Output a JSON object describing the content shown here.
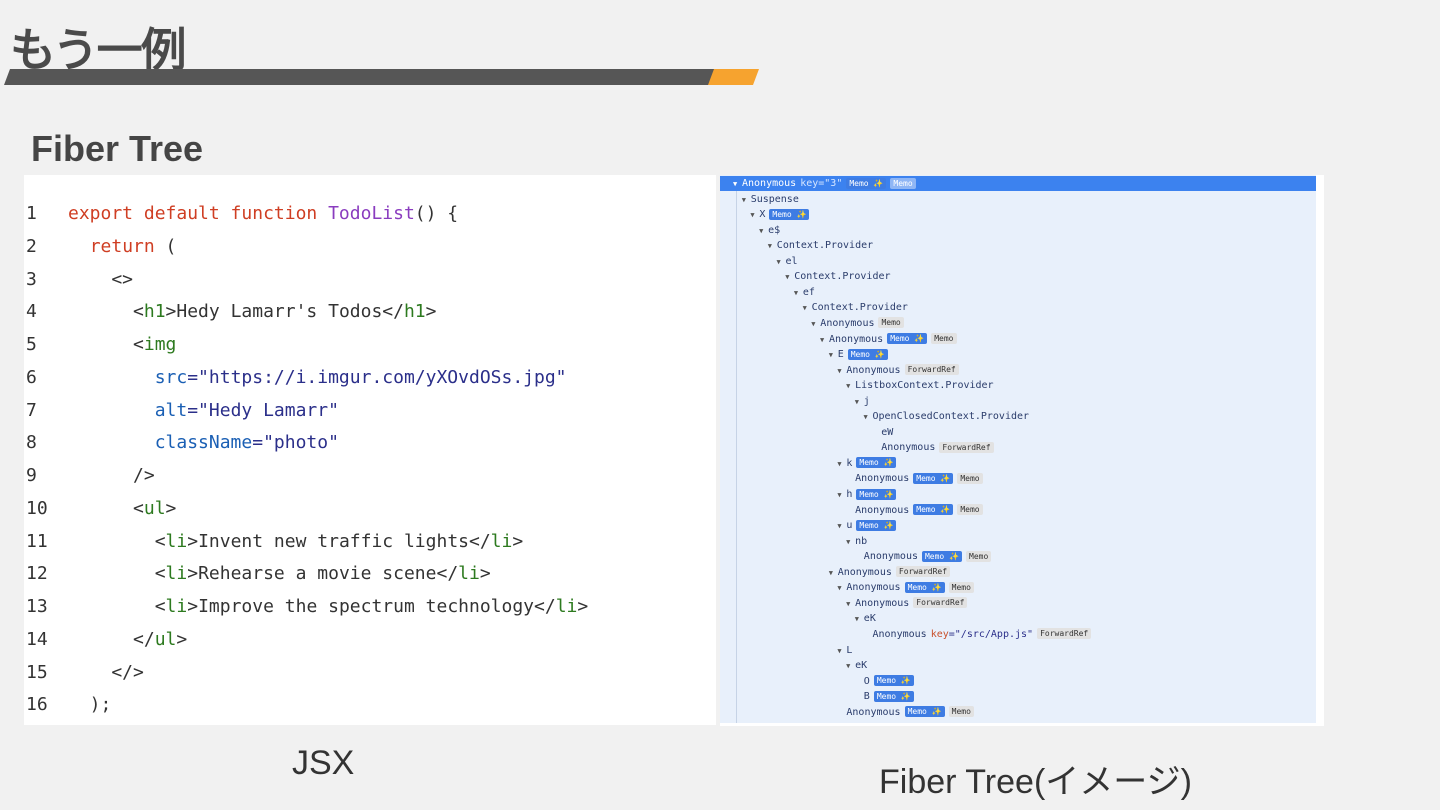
{
  "slide": {
    "title": "もう一例",
    "subtitle": "Fiber Tree",
    "caption_left": "JSX",
    "caption_right": "Fiber Tree(イメージ)",
    "accent_color": "#f6a32f",
    "bar_color": "#565656"
  },
  "code": {
    "lines": [
      {
        "n": "1",
        "tokens": [
          {
            "t": "export default function ",
            "c": "kw"
          },
          {
            "t": "TodoList",
            "c": "fn"
          },
          {
            "t": "() {",
            "c": ""
          }
        ]
      },
      {
        "n": "2",
        "tokens": [
          {
            "t": "  ",
            "c": ""
          },
          {
            "t": "return",
            "c": "kw"
          },
          {
            "t": " (",
            "c": ""
          }
        ]
      },
      {
        "n": "3",
        "tokens": [
          {
            "t": "    <>",
            "c": ""
          }
        ]
      },
      {
        "n": "4",
        "tokens": [
          {
            "t": "      <",
            "c": ""
          },
          {
            "t": "h1",
            "c": "tg"
          },
          {
            "t": ">Hedy Lamarr's Todos</",
            "c": ""
          },
          {
            "t": "h1",
            "c": "tg"
          },
          {
            "t": ">",
            "c": ""
          }
        ]
      },
      {
        "n": "5",
        "tokens": [
          {
            "t": "      <",
            "c": ""
          },
          {
            "t": "img",
            "c": "tg"
          }
        ]
      },
      {
        "n": "6",
        "tokens": [
          {
            "t": "        ",
            "c": ""
          },
          {
            "t": "src",
            "c": "at"
          },
          {
            "t": "=\"https://i.imgur.com/yXOvdOSs.jpg\"",
            "c": "st"
          }
        ]
      },
      {
        "n": "7",
        "tokens": [
          {
            "t": "        ",
            "c": ""
          },
          {
            "t": "alt",
            "c": "at"
          },
          {
            "t": "=\"Hedy Lamarr\"",
            "c": "st"
          }
        ]
      },
      {
        "n": "8",
        "tokens": [
          {
            "t": "        ",
            "c": ""
          },
          {
            "t": "className",
            "c": "at"
          },
          {
            "t": "=\"photo\"",
            "c": "st"
          }
        ]
      },
      {
        "n": "9",
        "tokens": [
          {
            "t": "      />",
            "c": ""
          }
        ]
      },
      {
        "n": "10",
        "tokens": [
          {
            "t": "      <",
            "c": ""
          },
          {
            "t": "ul",
            "c": "tg"
          },
          {
            "t": ">",
            "c": ""
          }
        ]
      },
      {
        "n": "11",
        "tokens": [
          {
            "t": "        <",
            "c": ""
          },
          {
            "t": "li",
            "c": "tg"
          },
          {
            "t": ">Invent new traffic lights</",
            "c": ""
          },
          {
            "t": "li",
            "c": "tg"
          },
          {
            "t": ">",
            "c": ""
          }
        ]
      },
      {
        "n": "12",
        "tokens": [
          {
            "t": "        <",
            "c": ""
          },
          {
            "t": "li",
            "c": "tg"
          },
          {
            "t": ">Rehearse a movie scene</",
            "c": ""
          },
          {
            "t": "li",
            "c": "tg"
          },
          {
            "t": ">",
            "c": ""
          }
        ]
      },
      {
        "n": "13",
        "tokens": [
          {
            "t": "        <",
            "c": ""
          },
          {
            "t": "li",
            "c": "tg"
          },
          {
            "t": ">Improve the spectrum technology</",
            "c": ""
          },
          {
            "t": "li",
            "c": "tg"
          },
          {
            "t": ">",
            "c": ""
          }
        ]
      },
      {
        "n": "14",
        "tokens": [
          {
            "t": "      </",
            "c": ""
          },
          {
            "t": "ul",
            "c": "tg"
          },
          {
            "t": ">",
            "c": ""
          }
        ]
      },
      {
        "n": "15",
        "tokens": [
          {
            "t": "    </>",
            "c": ""
          }
        ]
      },
      {
        "n": "16",
        "tokens": [
          {
            "t": "  );",
            "c": ""
          }
        ]
      }
    ]
  },
  "tree": {
    "rows": [
      {
        "label": "Anonymous",
        "d": 0,
        "tri": true,
        "selected": true,
        "prop_key": "key",
        "prop_val": "\"3\"",
        "badges": [
          {
            "t": "Memo ✨",
            "k": "blue"
          },
          {
            "t": "Memo",
            "k": "gray"
          }
        ]
      },
      {
        "label": "Suspense",
        "d": 1,
        "tri": true,
        "badges": []
      },
      {
        "label": "X",
        "d": 2,
        "tri": true,
        "badges": [
          {
            "t": "Memo ✨",
            "k": "blue"
          }
        ]
      },
      {
        "label": "e$",
        "d": 3,
        "tri": true,
        "badges": []
      },
      {
        "label": "Context.Provider",
        "d": 4,
        "tri": true,
        "badges": []
      },
      {
        "label": "el",
        "d": 5,
        "tri": true,
        "badges": []
      },
      {
        "label": "Context.Provider",
        "d": 6,
        "tri": true,
        "badges": []
      },
      {
        "label": "ef",
        "d": 7,
        "tri": true,
        "badges": []
      },
      {
        "label": "Context.Provider",
        "d": 8,
        "tri": true,
        "badges": []
      },
      {
        "label": "Anonymous",
        "d": 9,
        "tri": true,
        "badges": [
          {
            "t": "Memo",
            "k": "gray"
          }
        ]
      },
      {
        "label": "Anonymous",
        "d": 10,
        "tri": true,
        "badges": [
          {
            "t": "Memo ✨",
            "k": "blue"
          },
          {
            "t": "Memo",
            "k": "gray"
          }
        ]
      },
      {
        "label": "E",
        "d": 11,
        "tri": true,
        "badges": [
          {
            "t": "Memo ✨",
            "k": "blue"
          }
        ]
      },
      {
        "label": "Anonymous",
        "d": 12,
        "tri": true,
        "badges": [
          {
            "t": "ForwardRef",
            "k": "gray"
          }
        ]
      },
      {
        "label": "ListboxContext.Provider",
        "d": 13,
        "tri": true,
        "badges": []
      },
      {
        "label": "j",
        "d": 14,
        "tri": true,
        "badges": []
      },
      {
        "label": "OpenClosedContext.Provider",
        "d": 15,
        "tri": true,
        "badges": []
      },
      {
        "label": "eW",
        "d": 16,
        "tri": false,
        "badges": []
      },
      {
        "label": "Anonymous",
        "d": 16,
        "tri": false,
        "badges": [
          {
            "t": "ForwardRef",
            "k": "gray"
          }
        ]
      },
      {
        "label": "k",
        "d": 12,
        "tri": true,
        "badges": [
          {
            "t": "Memo ✨",
            "k": "blue"
          }
        ]
      },
      {
        "label": "Anonymous",
        "d": 13,
        "tri": false,
        "badges": [
          {
            "t": "Memo ✨",
            "k": "blue"
          },
          {
            "t": "Memo",
            "k": "gray"
          }
        ]
      },
      {
        "label": "h",
        "d": 12,
        "tri": true,
        "badges": [
          {
            "t": "Memo ✨",
            "k": "blue"
          }
        ]
      },
      {
        "label": "Anonymous",
        "d": 13,
        "tri": false,
        "badges": [
          {
            "t": "Memo ✨",
            "k": "blue"
          },
          {
            "t": "Memo",
            "k": "gray"
          }
        ]
      },
      {
        "label": "u",
        "d": 12,
        "tri": true,
        "badges": [
          {
            "t": "Memo ✨",
            "k": "blue"
          }
        ]
      },
      {
        "label": "nb",
        "d": 13,
        "tri": true,
        "badges": []
      },
      {
        "label": "Anonymous",
        "d": 14,
        "tri": false,
        "badges": [
          {
            "t": "Memo ✨",
            "k": "blue"
          },
          {
            "t": "Memo",
            "k": "gray"
          }
        ]
      },
      {
        "label": "Anonymous",
        "d": 11,
        "tri": true,
        "badges": [
          {
            "t": "ForwardRef",
            "k": "gray"
          }
        ]
      },
      {
        "label": "Anonymous",
        "d": 12,
        "tri": true,
        "badges": [
          {
            "t": "Memo ✨",
            "k": "blue"
          },
          {
            "t": "Memo",
            "k": "gray"
          }
        ]
      },
      {
        "label": "Anonymous",
        "d": 13,
        "tri": true,
        "badges": [
          {
            "t": "ForwardRef",
            "k": "gray"
          }
        ]
      },
      {
        "label": "eK",
        "d": 14,
        "tri": true,
        "badges": []
      },
      {
        "label": "Anonymous",
        "d": 15,
        "tri": false,
        "prop_key": "key",
        "prop_val": "\"/src/App.js\"",
        "badges": [
          {
            "t": "ForwardRef",
            "k": "gray"
          }
        ]
      },
      {
        "label": "L",
        "d": 12,
        "tri": true,
        "badges": []
      },
      {
        "label": "eK",
        "d": 13,
        "tri": true,
        "badges": []
      },
      {
        "label": "O",
        "d": 14,
        "tri": false,
        "badges": [
          {
            "t": "Memo ✨",
            "k": "blue"
          }
        ]
      },
      {
        "label": "B",
        "d": 14,
        "tri": false,
        "badges": [
          {
            "t": "Memo ✨",
            "k": "blue"
          }
        ]
      },
      {
        "label": "Anonymous",
        "d": 12,
        "tri": false,
        "badges": [
          {
            "t": "Memo ✨",
            "k": "blue"
          },
          {
            "t": "Memo",
            "k": "gray"
          }
        ]
      }
    ]
  }
}
